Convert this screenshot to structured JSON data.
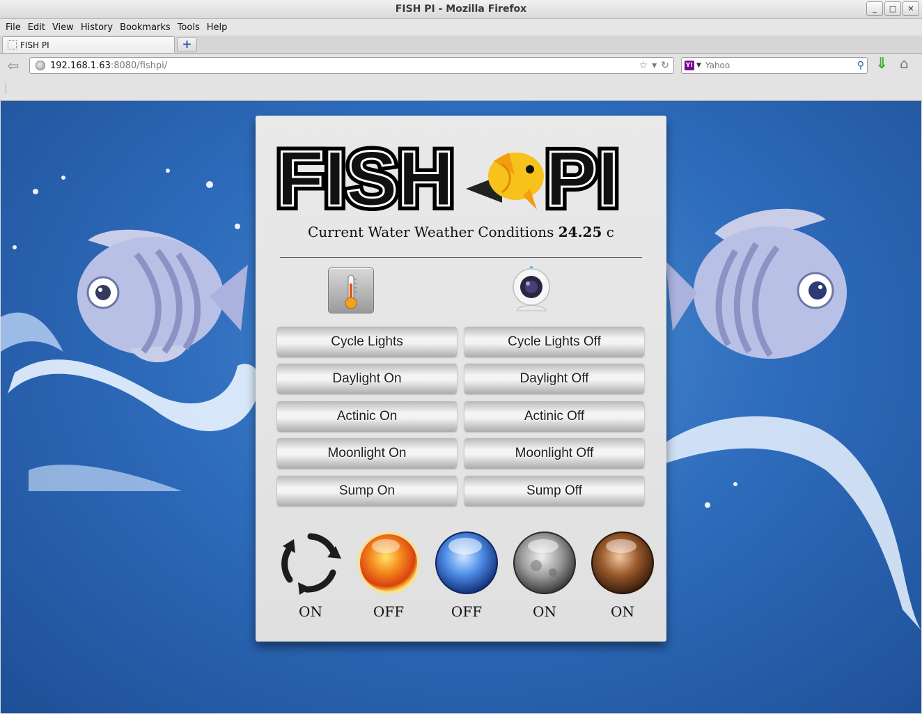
{
  "window": {
    "title": "FISH PI - Mozilla Firefox"
  },
  "menu": [
    "File",
    "Edit",
    "View",
    "History",
    "Bookmarks",
    "Tools",
    "Help"
  ],
  "tab": {
    "label": "FISH PI"
  },
  "address": {
    "host": "192.168.1.63",
    "path": ":8080/fishpi/"
  },
  "search": {
    "engine": "Yahoo",
    "placeholder": "Yahoo"
  },
  "panel": {
    "logo_text_left": "FISH",
    "logo_text_right": "PI",
    "conditions_label": "Current Water Weather Conditions",
    "temperature": "24.25",
    "unit": "c"
  },
  "controls": [
    {
      "on": "Cycle Lights",
      "off": "Cycle Lights Off"
    },
    {
      "on": "Daylight On",
      "off": "Daylight Off"
    },
    {
      "on": "Actinic On",
      "off": "Actinic Off"
    },
    {
      "on": "Moonlight On",
      "off": "Moonlight Off"
    },
    {
      "on": "Sump On",
      "off": "Sump Off"
    }
  ],
  "status": [
    {
      "icon": "cycle-icon",
      "state": "ON"
    },
    {
      "icon": "sun-orb-icon",
      "state": "OFF"
    },
    {
      "icon": "blue-orb-icon",
      "state": "OFF"
    },
    {
      "icon": "moon-orb-icon",
      "state": "ON"
    },
    {
      "icon": "bronze-orb-icon",
      "state": "ON"
    }
  ],
  "colors": {
    "background": "#2e6cbc",
    "panel": "#e6e6e6",
    "download": "#3fae2a"
  }
}
